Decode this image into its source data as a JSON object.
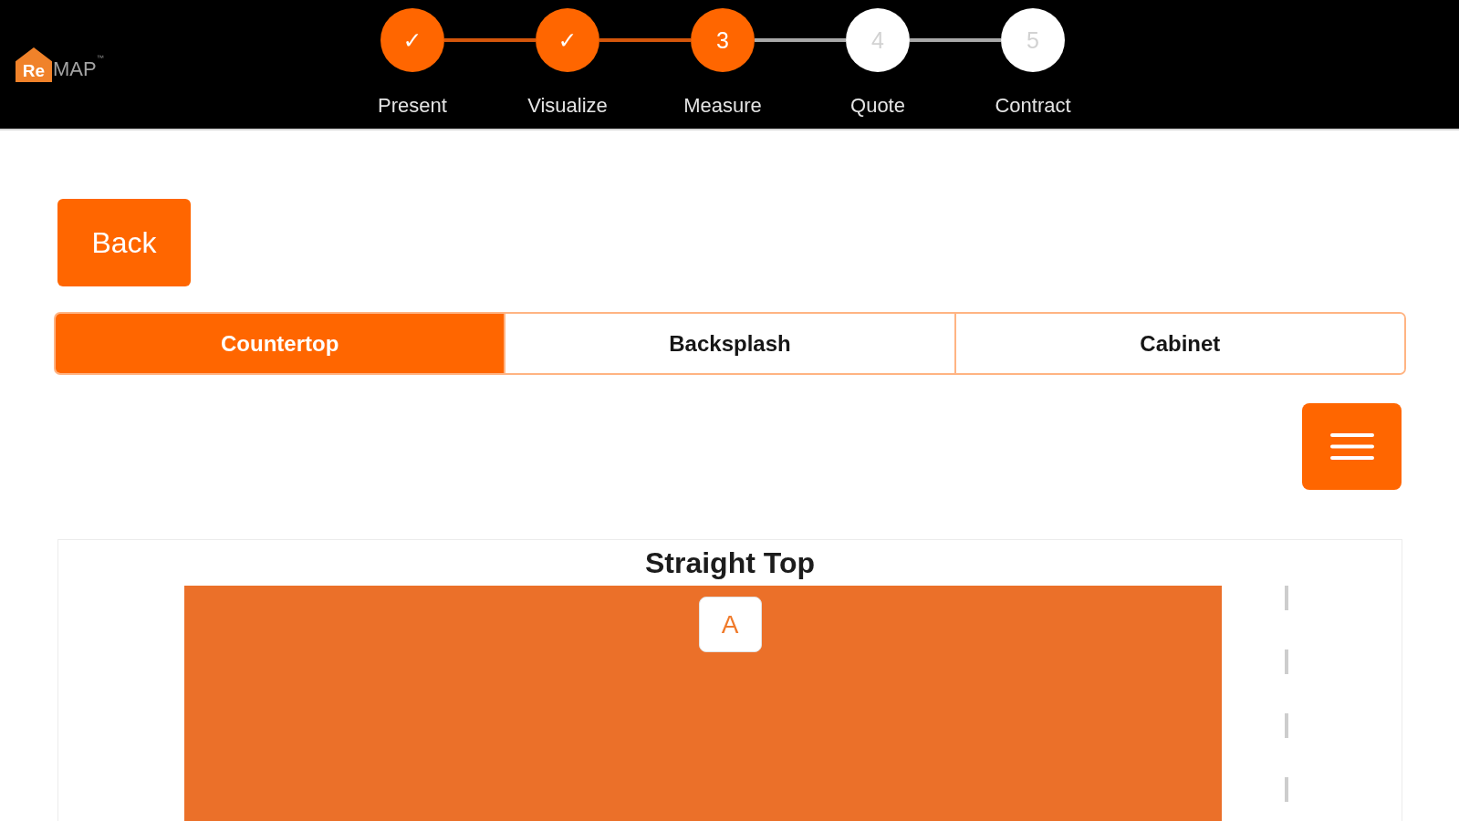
{
  "header": {
    "logo": {
      "mark": "Re",
      "text": "MAP",
      "trademark": "™"
    },
    "steps": [
      {
        "label": "Present",
        "symbol": "✓",
        "active": true
      },
      {
        "label": "Visualize",
        "symbol": "✓",
        "active": true
      },
      {
        "label": "Measure",
        "symbol": "3",
        "active": true
      },
      {
        "label": "Quote",
        "symbol": "4",
        "active": false
      },
      {
        "label": "Contract",
        "symbol": "5",
        "active": false
      }
    ]
  },
  "back_button": {
    "label": "Back"
  },
  "tabs": [
    {
      "label": "Countertop",
      "selected": true
    },
    {
      "label": "Backsplash",
      "selected": false
    },
    {
      "label": "Cabinet",
      "selected": false
    }
  ],
  "drawing": {
    "title": "Straight Top",
    "edge_labels": [
      "A"
    ]
  }
}
